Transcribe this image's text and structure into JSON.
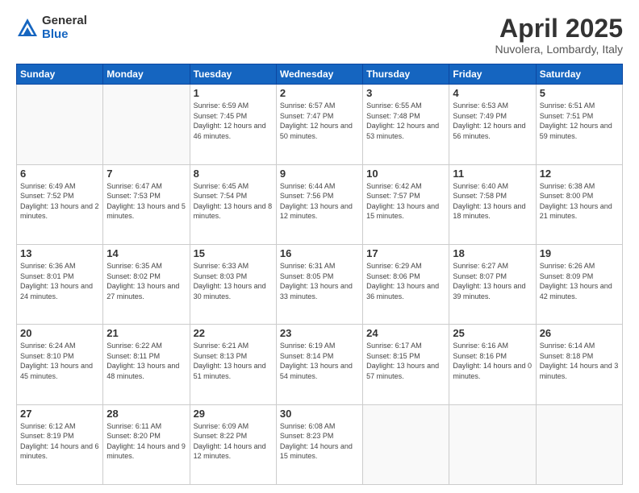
{
  "logo": {
    "general": "General",
    "blue": "Blue"
  },
  "title": "April 2025",
  "location": "Nuvolera, Lombardy, Italy",
  "weekdays": [
    "Sunday",
    "Monday",
    "Tuesday",
    "Wednesday",
    "Thursday",
    "Friday",
    "Saturday"
  ],
  "weeks": [
    [
      {
        "day": "",
        "info": ""
      },
      {
        "day": "",
        "info": ""
      },
      {
        "day": "1",
        "info": "Sunrise: 6:59 AM\nSunset: 7:45 PM\nDaylight: 12 hours and 46 minutes."
      },
      {
        "day": "2",
        "info": "Sunrise: 6:57 AM\nSunset: 7:47 PM\nDaylight: 12 hours and 50 minutes."
      },
      {
        "day": "3",
        "info": "Sunrise: 6:55 AM\nSunset: 7:48 PM\nDaylight: 12 hours and 53 minutes."
      },
      {
        "day": "4",
        "info": "Sunrise: 6:53 AM\nSunset: 7:49 PM\nDaylight: 12 hours and 56 minutes."
      },
      {
        "day": "5",
        "info": "Sunrise: 6:51 AM\nSunset: 7:51 PM\nDaylight: 12 hours and 59 minutes."
      }
    ],
    [
      {
        "day": "6",
        "info": "Sunrise: 6:49 AM\nSunset: 7:52 PM\nDaylight: 13 hours and 2 minutes."
      },
      {
        "day": "7",
        "info": "Sunrise: 6:47 AM\nSunset: 7:53 PM\nDaylight: 13 hours and 5 minutes."
      },
      {
        "day": "8",
        "info": "Sunrise: 6:45 AM\nSunset: 7:54 PM\nDaylight: 13 hours and 8 minutes."
      },
      {
        "day": "9",
        "info": "Sunrise: 6:44 AM\nSunset: 7:56 PM\nDaylight: 13 hours and 12 minutes."
      },
      {
        "day": "10",
        "info": "Sunrise: 6:42 AM\nSunset: 7:57 PM\nDaylight: 13 hours and 15 minutes."
      },
      {
        "day": "11",
        "info": "Sunrise: 6:40 AM\nSunset: 7:58 PM\nDaylight: 13 hours and 18 minutes."
      },
      {
        "day": "12",
        "info": "Sunrise: 6:38 AM\nSunset: 8:00 PM\nDaylight: 13 hours and 21 minutes."
      }
    ],
    [
      {
        "day": "13",
        "info": "Sunrise: 6:36 AM\nSunset: 8:01 PM\nDaylight: 13 hours and 24 minutes."
      },
      {
        "day": "14",
        "info": "Sunrise: 6:35 AM\nSunset: 8:02 PM\nDaylight: 13 hours and 27 minutes."
      },
      {
        "day": "15",
        "info": "Sunrise: 6:33 AM\nSunset: 8:03 PM\nDaylight: 13 hours and 30 minutes."
      },
      {
        "day": "16",
        "info": "Sunrise: 6:31 AM\nSunset: 8:05 PM\nDaylight: 13 hours and 33 minutes."
      },
      {
        "day": "17",
        "info": "Sunrise: 6:29 AM\nSunset: 8:06 PM\nDaylight: 13 hours and 36 minutes."
      },
      {
        "day": "18",
        "info": "Sunrise: 6:27 AM\nSunset: 8:07 PM\nDaylight: 13 hours and 39 minutes."
      },
      {
        "day": "19",
        "info": "Sunrise: 6:26 AM\nSunset: 8:09 PM\nDaylight: 13 hours and 42 minutes."
      }
    ],
    [
      {
        "day": "20",
        "info": "Sunrise: 6:24 AM\nSunset: 8:10 PM\nDaylight: 13 hours and 45 minutes."
      },
      {
        "day": "21",
        "info": "Sunrise: 6:22 AM\nSunset: 8:11 PM\nDaylight: 13 hours and 48 minutes."
      },
      {
        "day": "22",
        "info": "Sunrise: 6:21 AM\nSunset: 8:13 PM\nDaylight: 13 hours and 51 minutes."
      },
      {
        "day": "23",
        "info": "Sunrise: 6:19 AM\nSunset: 8:14 PM\nDaylight: 13 hours and 54 minutes."
      },
      {
        "day": "24",
        "info": "Sunrise: 6:17 AM\nSunset: 8:15 PM\nDaylight: 13 hours and 57 minutes."
      },
      {
        "day": "25",
        "info": "Sunrise: 6:16 AM\nSunset: 8:16 PM\nDaylight: 14 hours and 0 minutes."
      },
      {
        "day": "26",
        "info": "Sunrise: 6:14 AM\nSunset: 8:18 PM\nDaylight: 14 hours and 3 minutes."
      }
    ],
    [
      {
        "day": "27",
        "info": "Sunrise: 6:12 AM\nSunset: 8:19 PM\nDaylight: 14 hours and 6 minutes."
      },
      {
        "day": "28",
        "info": "Sunrise: 6:11 AM\nSunset: 8:20 PM\nDaylight: 14 hours and 9 minutes."
      },
      {
        "day": "29",
        "info": "Sunrise: 6:09 AM\nSunset: 8:22 PM\nDaylight: 14 hours and 12 minutes."
      },
      {
        "day": "30",
        "info": "Sunrise: 6:08 AM\nSunset: 8:23 PM\nDaylight: 14 hours and 15 minutes."
      },
      {
        "day": "",
        "info": ""
      },
      {
        "day": "",
        "info": ""
      },
      {
        "day": "",
        "info": ""
      }
    ]
  ]
}
